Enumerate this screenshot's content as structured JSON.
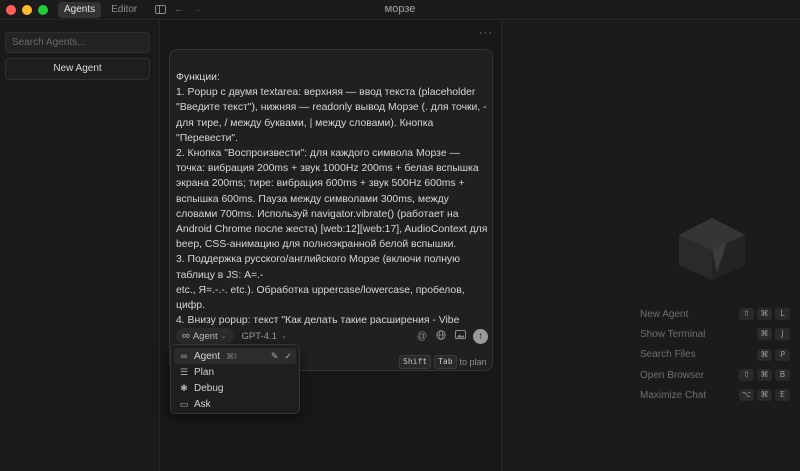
{
  "window": {
    "title": "морзе",
    "tabs": [
      {
        "label": "Agents",
        "active": true
      },
      {
        "label": "Editor",
        "active": false
      }
    ]
  },
  "sidebar": {
    "search_placeholder": "Search Agents...",
    "new_agent_label": "New Agent"
  },
  "composer": {
    "more_label": "···",
    "prompt_text": "Функции:\n1. Popup с двумя textarea: верхняя — ввод текста (placeholder \"Введите текст\"), нижняя — readonly вывод Морзе (. для точки, - для тире, / между буквами, | между словами). Кнопка \"Перевести\".\n2. Кнопка \"Воспроизвести\": для каждого символа Морзе — точка: вибрация 200ms + звук 1000Hz 200ms + белая вспышка экрана 200ms; тире: вибрация 600ms + звук 500Hz 600ms + вспышка 600ms. Пауза между символами 300ms, между словами 700ms. Используй navigator.vibrate() (работает на Android Chrome после жеста) [web:12][web:17], AudioContext для beep, CSS-анимацию для полноэкранной белой вспышки.\n3. Поддержка русского/английского Морзе (включи полную таблицу в JS: А=.-\netc., Я=.-.-. etc.). Обработка uppercase/lowercase, пробелов, цифр.\n4. Внизу popup: текст \"Как делать такие расширения - Vibe",
    "mode_label": "Agent",
    "model_label": "GPT-4.1",
    "hint": {
      "key1": "Shift",
      "key2": "Tab",
      "suffix": "to plan"
    }
  },
  "mode_menu": {
    "items": [
      {
        "label": "Agent",
        "icon": "infinity-icon",
        "glyph": "∞",
        "shortcut": "⌘I",
        "selected": true
      },
      {
        "label": "Plan",
        "icon": "list-icon",
        "glyph": "☰",
        "selected": false
      },
      {
        "label": "Debug",
        "icon": "bug-icon",
        "glyph": "✱",
        "selected": false
      },
      {
        "label": "Ask",
        "icon": "chat-icon",
        "glyph": "▭",
        "selected": false
      }
    ]
  },
  "right_panel": {
    "shortcuts": [
      {
        "label": "New Agent",
        "keys": [
          "⇧",
          "⌘",
          "L"
        ]
      },
      {
        "label": "Show Terminal",
        "keys": [
          "⌘",
          "J"
        ]
      },
      {
        "label": "Search Files",
        "keys": [
          "⌘",
          "P"
        ]
      },
      {
        "label": "Open Browser",
        "keys": [
          "⇧",
          "⌘",
          "B"
        ]
      },
      {
        "label": "Maximize Chat",
        "keys": [
          "⌥",
          "⌘",
          "E"
        ]
      }
    ]
  },
  "colors": {
    "background": "#181818",
    "panel": "#202020",
    "text": "#d7d7d7",
    "muted": "#6f6f6f"
  }
}
